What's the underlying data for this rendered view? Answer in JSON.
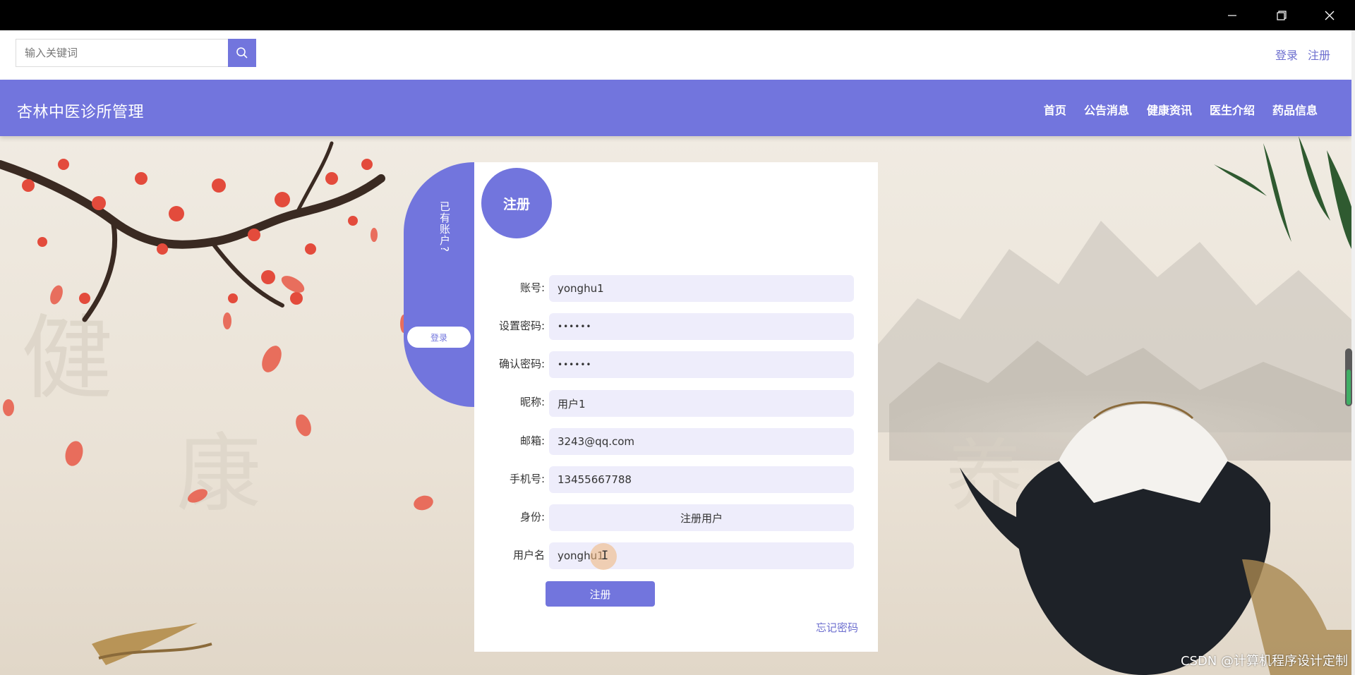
{
  "window": {
    "controls": [
      "minimize-icon",
      "restore-icon",
      "close-icon"
    ]
  },
  "search": {
    "placeholder": "输入关键词",
    "button_icon": "search-icon"
  },
  "auth": {
    "login": "登录",
    "register": "注册"
  },
  "site": {
    "title": "杏林中医诊所管理"
  },
  "nav": {
    "items": [
      "首页",
      "公告消息",
      "健康资讯",
      "医生介绍",
      "药品信息"
    ]
  },
  "side": {
    "prompt": "已有账户?",
    "login_button": "登录"
  },
  "form": {
    "title": "注册",
    "fields": [
      {
        "label": "账号:",
        "value": "yonghu1"
      },
      {
        "label": "设置密码:",
        "value": "••••••"
      },
      {
        "label": "确认密码:",
        "value": "••••••"
      },
      {
        "label": "昵称:",
        "value": "用户1"
      },
      {
        "label": "邮箱:",
        "value": "3243@qq.com"
      },
      {
        "label": "手机号:",
        "value": "13455667788"
      },
      {
        "label": "身份:",
        "value": "注册用户"
      },
      {
        "label": "用户名",
        "value": "yonghu1"
      }
    ],
    "submit": "注册",
    "forgot": "忘记密码"
  },
  "watermark": "CSDN @计算机程序设计定制",
  "colors": {
    "accent": "#7275dd",
    "field_bg": "#eeedfb",
    "link": "#6d6fcf"
  }
}
